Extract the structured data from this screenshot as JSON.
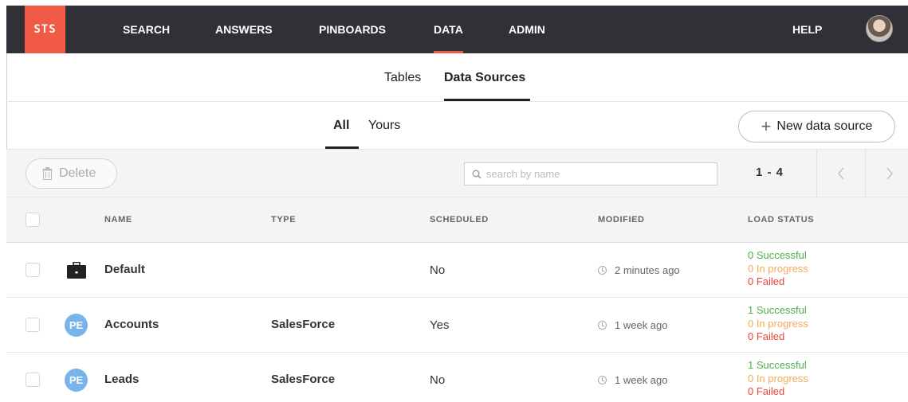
{
  "nav": {
    "logo_text": "STS",
    "items": [
      {
        "label": "SEARCH"
      },
      {
        "label": "ANSWERS"
      },
      {
        "label": "PINBOARDS"
      },
      {
        "label": "DATA",
        "active": true
      },
      {
        "label": "ADMIN"
      }
    ],
    "help_label": "HELP",
    "accent_color": "#f05a47",
    "background_color": "#2f3136"
  },
  "tabs": [
    {
      "label": "Tables"
    },
    {
      "label": "Data Sources",
      "active": true
    }
  ],
  "subtabs": [
    {
      "label": "All",
      "active": true
    },
    {
      "label": "Yours"
    }
  ],
  "new_source_button": {
    "label": "New data source",
    "icon": "plus-icon"
  },
  "toolbar": {
    "delete_label": "Delete",
    "delete_icon": "trash-icon",
    "search_placeholder": "search by name",
    "search_value": "",
    "pager_text": "1 - 4",
    "prev_icon": "chevron-left-icon",
    "next_icon": "chevron-right-icon"
  },
  "table": {
    "columns": [
      "NAME",
      "TYPE",
      "SCHEDULED",
      "MODIFIED",
      "LOAD STATUS"
    ],
    "rows": [
      {
        "icon": "briefcase-icon",
        "name": "Default",
        "type": "",
        "scheduled": "No",
        "modified": "2 minutes ago",
        "successful": "0 Successful",
        "in_progress": "0 In progress",
        "failed": "0 Failed"
      },
      {
        "icon": "PE",
        "name": "Accounts",
        "type": "SalesForce",
        "scheduled": "Yes",
        "modified": "1 week ago",
        "successful": "1 Successful",
        "in_progress": "0 In progress",
        "failed": "0 Failed"
      },
      {
        "icon": "PE",
        "name": "Leads",
        "type": "SalesForce",
        "scheduled": "No",
        "modified": "1 week ago",
        "successful": "1 Successful",
        "in_progress": "0 In progress",
        "failed": "0 Failed"
      }
    ]
  },
  "status_colors": {
    "successful": "#4caf50",
    "in_progress": "#f5a95a",
    "failed": "#e8453c"
  }
}
